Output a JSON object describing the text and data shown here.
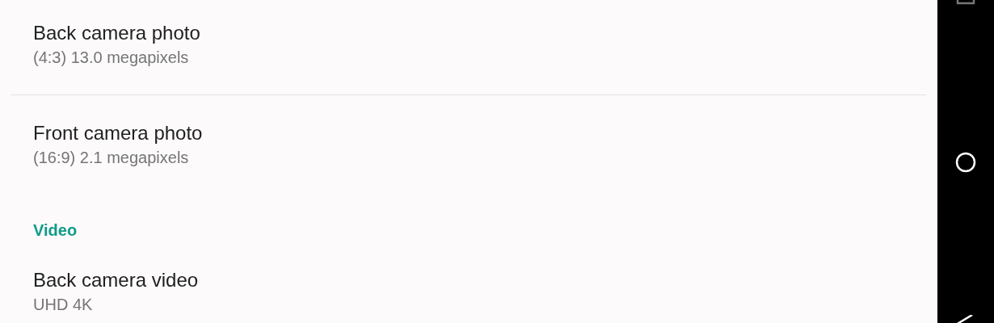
{
  "settings": {
    "items": [
      {
        "kind": "preference",
        "title": "Back camera photo",
        "summary": "(4:3) 13.0 megapixels",
        "divider": true
      },
      {
        "kind": "preference",
        "title": "Front camera photo",
        "summary": "(16:9) 2.1 megapixels",
        "divider": false
      },
      {
        "kind": "category",
        "title": "Video"
      },
      {
        "kind": "preference",
        "title": "Back camera video",
        "summary": "UHD 4K",
        "divider": false
      }
    ]
  }
}
